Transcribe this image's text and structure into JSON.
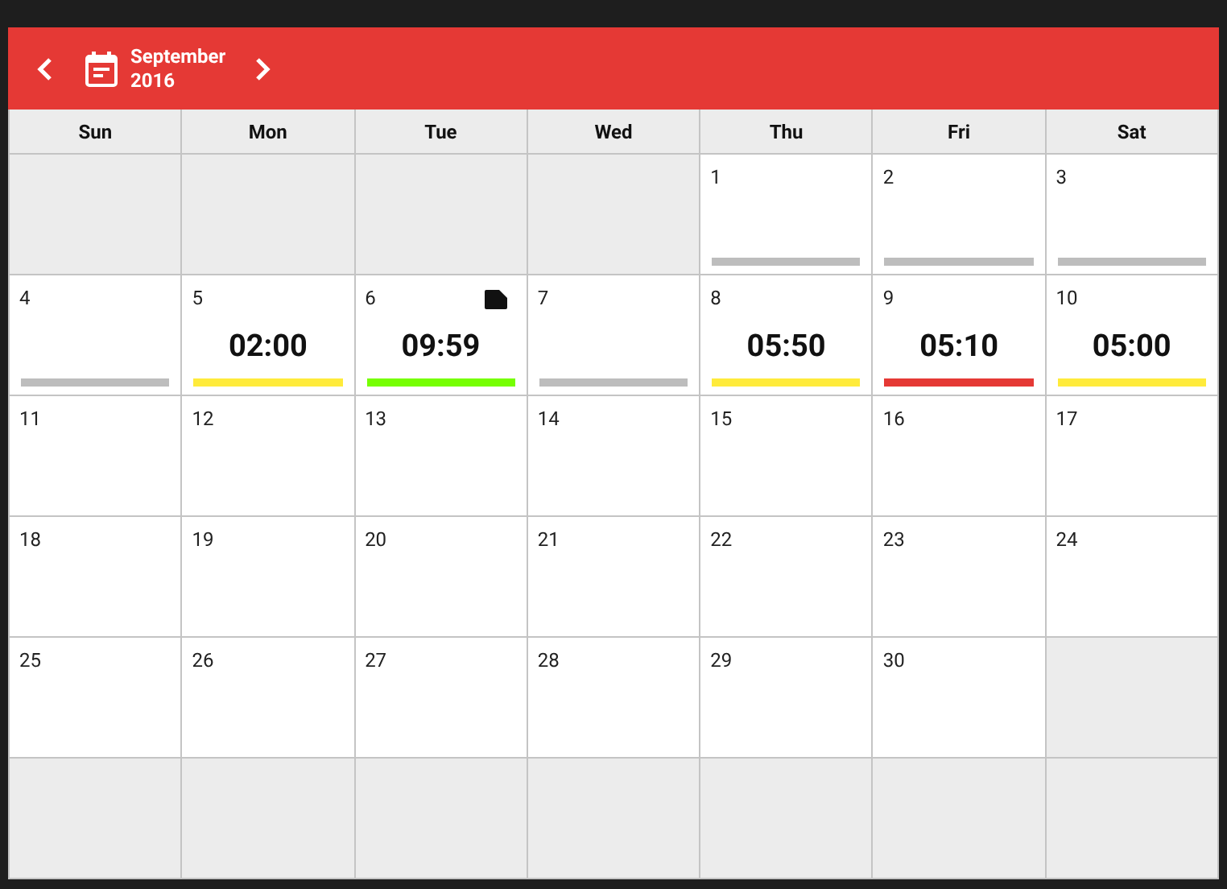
{
  "header": {
    "month": "September",
    "year": "2016"
  },
  "weekdays": [
    "Sun",
    "Mon",
    "Tue",
    "Wed",
    "Thu",
    "Fri",
    "Sat"
  ],
  "weeks": [
    [
      {
        "kind": "empty"
      },
      {
        "kind": "empty"
      },
      {
        "kind": "empty"
      },
      {
        "kind": "empty"
      },
      {
        "kind": "day",
        "day": "1",
        "color": "#bdbdbd"
      },
      {
        "kind": "day",
        "day": "2",
        "color": "#bdbdbd"
      },
      {
        "kind": "day",
        "day": "3",
        "color": "#bdbdbd"
      }
    ],
    [
      {
        "kind": "day",
        "day": "4",
        "color": "#bdbdbd"
      },
      {
        "kind": "day",
        "day": "5",
        "time": "02:00",
        "color": "#ffeb3b"
      },
      {
        "kind": "day",
        "day": "6",
        "time": "09:59",
        "color": "#76ff03",
        "note": true
      },
      {
        "kind": "day",
        "day": "7",
        "color": "#bdbdbd"
      },
      {
        "kind": "day",
        "day": "8",
        "time": "05:50",
        "color": "#ffeb3b"
      },
      {
        "kind": "day",
        "day": "9",
        "time": "05:10",
        "color": "#e53935"
      },
      {
        "kind": "day",
        "day": "10",
        "time": "05:00",
        "color": "#ffeb3b"
      }
    ],
    [
      {
        "kind": "day",
        "day": "11"
      },
      {
        "kind": "day",
        "day": "12"
      },
      {
        "kind": "day",
        "day": "13"
      },
      {
        "kind": "day",
        "day": "14"
      },
      {
        "kind": "day",
        "day": "15"
      },
      {
        "kind": "day",
        "day": "16"
      },
      {
        "kind": "day",
        "day": "17"
      }
    ],
    [
      {
        "kind": "day",
        "day": "18"
      },
      {
        "kind": "day",
        "day": "19"
      },
      {
        "kind": "day",
        "day": "20"
      },
      {
        "kind": "day",
        "day": "21"
      },
      {
        "kind": "day",
        "day": "22"
      },
      {
        "kind": "day",
        "day": "23"
      },
      {
        "kind": "day",
        "day": "24"
      }
    ],
    [
      {
        "kind": "day",
        "day": "25"
      },
      {
        "kind": "day",
        "day": "26"
      },
      {
        "kind": "day",
        "day": "27"
      },
      {
        "kind": "day",
        "day": "28"
      },
      {
        "kind": "day",
        "day": "29"
      },
      {
        "kind": "day",
        "day": "30"
      },
      {
        "kind": "empty"
      }
    ],
    [
      {
        "kind": "empty"
      },
      {
        "kind": "empty"
      },
      {
        "kind": "empty"
      },
      {
        "kind": "empty"
      },
      {
        "kind": "empty"
      },
      {
        "kind": "empty"
      },
      {
        "kind": "empty"
      }
    ]
  ]
}
